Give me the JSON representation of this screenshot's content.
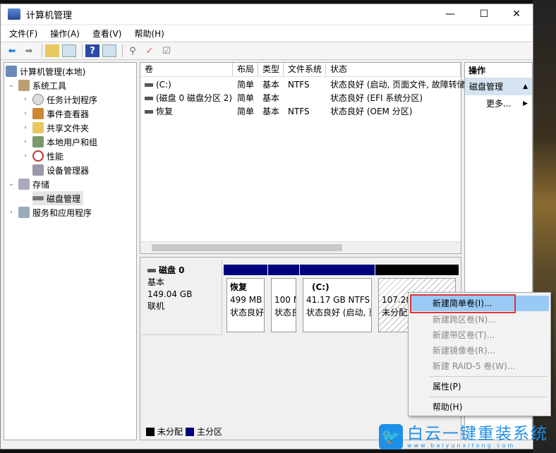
{
  "window": {
    "title": "计算机管理",
    "minimize": "—",
    "maximize": "☐",
    "close": "✕"
  },
  "menu": [
    "文件(F)",
    "操作(A)",
    "查看(V)",
    "帮助(H)"
  ],
  "toolbar": [
    "back-icon",
    "forward-icon",
    "up-folder-icon",
    "show-hide-tree-icon",
    "help-icon",
    "action-pane-icon",
    "connect-icon",
    "properties-icon",
    "checklist-icon"
  ],
  "tree": {
    "root": "计算机管理(本地)",
    "items": [
      {
        "label": "系统工具",
        "level": 1,
        "expanded": true
      },
      {
        "label": "任务计划程序",
        "level": 2
      },
      {
        "label": "事件查看器",
        "level": 2
      },
      {
        "label": "共享文件夹",
        "level": 2
      },
      {
        "label": "本地用户和组",
        "level": 2
      },
      {
        "label": "性能",
        "level": 2
      },
      {
        "label": "设备管理器",
        "level": 2
      },
      {
        "label": "存储",
        "level": 1,
        "expanded": true
      },
      {
        "label": "磁盘管理",
        "level": 2,
        "selected": true
      },
      {
        "label": "服务和应用程序",
        "level": 1
      }
    ]
  },
  "volumes": {
    "headers": [
      "卷",
      "布局",
      "类型",
      "文件系统",
      "状态"
    ],
    "rows": [
      [
        "(C:)",
        "简单",
        "基本",
        "NTFS",
        "状态良好 (启动, 页面文件, 故障转储"
      ],
      [
        "(磁盘 0 磁盘分区 2)",
        "简单",
        "基本",
        "",
        "状态良好 (EFI 系统分区)"
      ],
      [
        "恢复",
        "简单",
        "基本",
        "NTFS",
        "状态良好 (OEM 分区)"
      ]
    ]
  },
  "disk": {
    "name": "磁盘 0",
    "type": "基本",
    "size": "149.04 GB",
    "state": "联机",
    "partitions": [
      {
        "name": "恢复",
        "size": "499 MB",
        "status": "状态良好"
      },
      {
        "name": "",
        "size": "100 M",
        "status": "状态良"
      },
      {
        "name": "(C:)",
        "size": "41.17 GB NTFS",
        "status": "状态良好 (启动, 页"
      },
      {
        "name": "",
        "size": "107.28",
        "status": "未分配"
      }
    ]
  },
  "legend": [
    {
      "label": "未分配",
      "color": "#000000"
    },
    {
      "label": "主分区",
      "color": "#00007f"
    }
  ],
  "actions": {
    "header": "操作",
    "section": "磁盘管理",
    "more": "更多..."
  },
  "context_menu": {
    "items": [
      "新建简单卷(I)...",
      "新建跨区卷(N)...",
      "新建带区卷(T)...",
      "新建镜像卷(R)...",
      "新建 RAID-5 卷(W)...",
      "属性(P)",
      "帮助(H)"
    ]
  },
  "watermark": {
    "brand": "白云一键重装系统",
    "url": "www.baiyunxitong.com"
  },
  "colors": {
    "primary_partition": "#00007f",
    "unallocated": "#000000",
    "highlight": "#99c9f5",
    "callout": "#d9373b"
  }
}
